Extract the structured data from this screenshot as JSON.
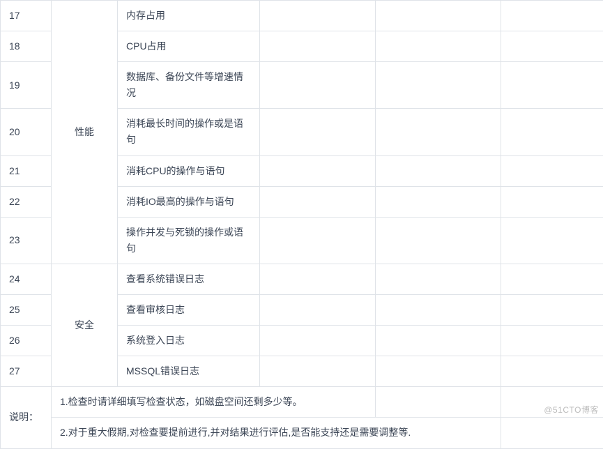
{
  "rows": {
    "r17": {
      "num": "17",
      "cat": "性能",
      "item": "内存占用"
    },
    "r18": {
      "num": "18",
      "item": "CPU占用"
    },
    "r19": {
      "num": "19",
      "item": "数据库、备份文件等增速情况"
    },
    "r20": {
      "num": "20",
      "item": "消耗最长时间的操作或是语句"
    },
    "r21": {
      "num": "21",
      "item": "消耗CPU的操作与语句"
    },
    "r22": {
      "num": "22",
      "item": "消耗IO最高的操作与语句"
    },
    "r23": {
      "num": "23",
      "item": "操作并发与死锁的操作或语句"
    },
    "r24": {
      "num": "24",
      "cat": "安全",
      "item": "查看系统错误日志"
    },
    "r25": {
      "num": "25",
      "item": "查看审核日志"
    },
    "r26": {
      "num": "26",
      "item": "系统登入日志"
    },
    "r27": {
      "num": "27",
      "item": "MSSQL错误日志"
    }
  },
  "notes": {
    "label": "说明：",
    "n1": "1.检查时请详细填写检查状态，如磁盘空间还剩多少等。",
    "n2": "2.对于重大假期,对检查要提前进行,并对结果进行评估,是否能支持还是需要调整等."
  },
  "watermark": "@51CTO博客"
}
